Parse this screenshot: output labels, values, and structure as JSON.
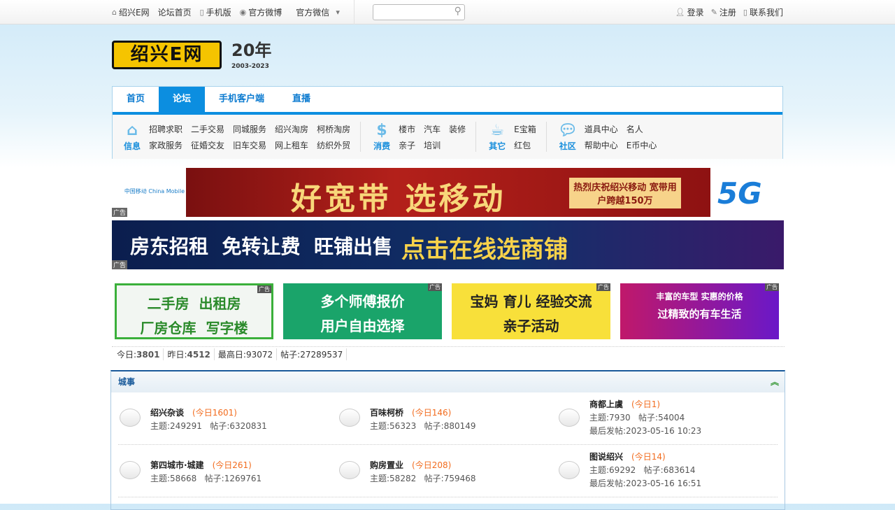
{
  "topbar": {
    "items": [
      "绍兴E网",
      "论坛首页",
      "手机版",
      "官方微博",
      "官方微信"
    ],
    "right": [
      "登录",
      "注册",
      "联系我们"
    ],
    "search_placeholder": ""
  },
  "logo": {
    "text": "绍兴E网",
    "anniv": "20年",
    "years": "2003-2023"
  },
  "nav": {
    "tabs": [
      "首页",
      "论坛",
      "手机客户端",
      "直播"
    ],
    "groups": [
      {
        "label": "信息",
        "links": [
          "招聘求职",
          "二手交易",
          "同城服务",
          "绍兴淘房",
          "柯桥淘房",
          "家政服务",
          "征婚交友",
          "旧车交易",
          "网上租车",
          "纺织外贸"
        ]
      },
      {
        "label": "消费",
        "links": [
          "楼市",
          "汽车",
          "装修",
          "亲子",
          "培训"
        ]
      },
      {
        "label": "其它",
        "links": [
          "E宝箱",
          "红包"
        ]
      },
      {
        "label": "社区",
        "links": [
          "道具中心",
          "名人",
          "帮助中心",
          "E币中心"
        ]
      }
    ]
  },
  "ads": {
    "tag": "广告",
    "banner1": "好宽带 选移动",
    "banner1_sub": "热烈庆祝绍兴移动 宽带用户跨越150万",
    "banner1_brand": "中国移动 China Mobile",
    "banner1_5g": "5G",
    "banner2": "房东招租  免转让费  旺铺出售",
    "banner2_hl": "点击在线选商铺",
    "small": [
      {
        "l1": "二手房  出租房",
        "l2": "厂房仓库  写字楼"
      },
      {
        "l1": "多个师傅报价",
        "l2": "用户自由选择"
      },
      {
        "l1": "宝妈 育儿 经验交流",
        "l2": "亲子活动"
      },
      {
        "l1": "丰富的车型 实惠的价格",
        "l2": "过精致的有车生活"
      }
    ]
  },
  "stats": {
    "today_label": "今日:",
    "today": "3801",
    "yesterday_label": "昨日:",
    "yesterday": "4512",
    "max_label": "最高日:",
    "max": "93072",
    "posts_label": "帖子:",
    "posts": "27289537"
  },
  "forum": {
    "title": "城事",
    "collapse_icon": "double-chevron-up",
    "boards": [
      {
        "name": "绍兴杂谈",
        "today": "(今日1601)",
        "topics": "主题:249291",
        "posts": "帖子:6320831"
      },
      {
        "name": "百味柯桥",
        "today": "(今日146)",
        "topics": "主题:56323",
        "posts": "帖子:880149"
      },
      {
        "name": "商都上虞",
        "today": "(今日1)",
        "topics": "主题:7930",
        "posts": "帖子:54004",
        "last": "最后发帖:2023-05-16 10:23"
      },
      {
        "name": "第四城市·城建",
        "today": "(今日261)",
        "topics": "主题:58668",
        "posts": "帖子:1269761"
      },
      {
        "name": "购房置业",
        "today": "(今日208)",
        "topics": "主题:58282",
        "posts": "帖子:759468"
      },
      {
        "name": "图说绍兴",
        "today": "(今日14)",
        "topics": "主题:69292",
        "posts": "帖子:683614",
        "last": "最后发帖:2023-05-16 16:51"
      }
    ]
  }
}
